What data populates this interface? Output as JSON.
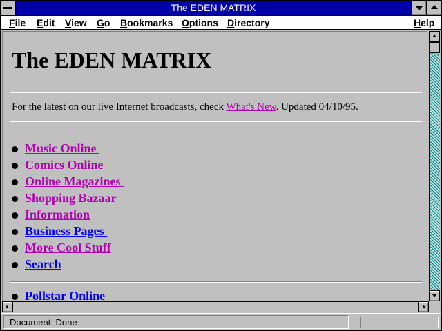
{
  "window": {
    "title": "The EDEN MATRIX"
  },
  "menubar": {
    "items": [
      {
        "label": "File"
      },
      {
        "label": "Edit"
      },
      {
        "label": "View"
      },
      {
        "label": "Go"
      },
      {
        "label": "Bookmarks"
      },
      {
        "label": "Options"
      },
      {
        "label": "Directory"
      },
      {
        "label": "Help"
      }
    ]
  },
  "page": {
    "title": "The EDEN MATRIX",
    "notice_prefix": "For the latest on our live Internet broadcasts, check ",
    "notice_link": "What's New",
    "notice_suffix": ". Updated 04/10/95.",
    "links": [
      {
        "label": "Music Online ",
        "visited": true
      },
      {
        "label": "Comics Online",
        "visited": true
      },
      {
        "label": "Online Magazines ",
        "visited": true
      },
      {
        "label": "Shopping Bazaar",
        "visited": true
      },
      {
        "label": "Information",
        "visited": true
      },
      {
        "label": "Business Pages ",
        "visited": false
      },
      {
        "label": "More Cool Stuff",
        "visited": true
      },
      {
        "label": "Search",
        "visited": false
      }
    ],
    "links2": [
      {
        "label": "Pollstar Online",
        "visited": false
      }
    ]
  },
  "status": {
    "text": "Document: Done"
  },
  "colors": {
    "visited_link": "#b000b0",
    "unvisited_link": "#0000ee",
    "titlebar": "#0000a8"
  }
}
